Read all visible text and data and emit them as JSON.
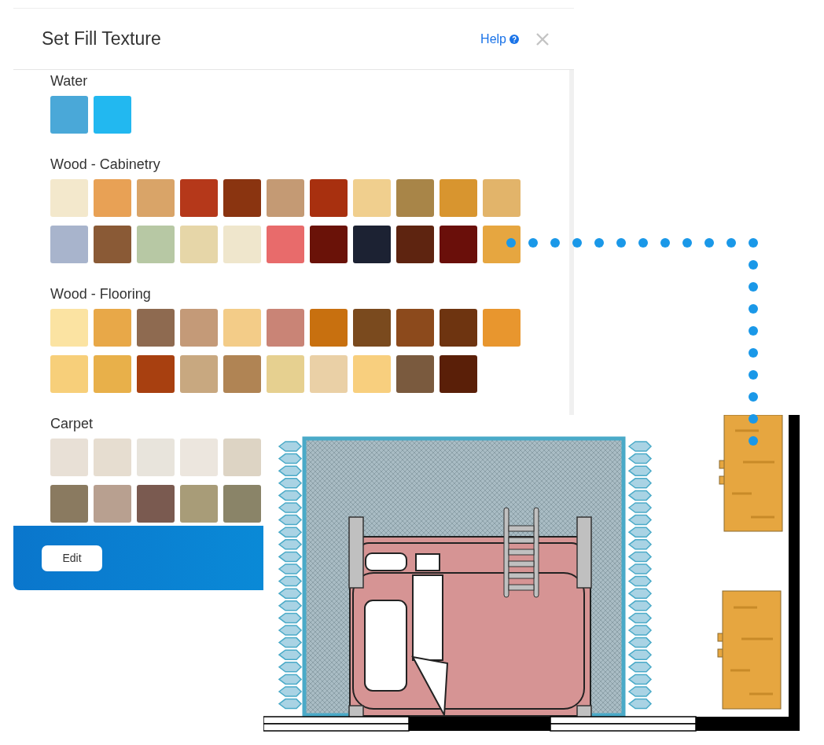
{
  "dialog": {
    "title": "Set Fill Texture",
    "help_link": "Help"
  },
  "sections": [
    {
      "label": "Water",
      "rows": [
        [
          {
            "color": "#4aa8d8"
          },
          {
            "color": "#22b8f0"
          }
        ]
      ]
    },
    {
      "label": "Wood - Cabinetry",
      "rows": [
        [
          {
            "color": "#f3e8cc"
          },
          {
            "color": "#e8a155"
          },
          {
            "color": "#d9a468"
          },
          {
            "color": "#b5381a"
          },
          {
            "color": "#8a3410"
          },
          {
            "color": "#c49a74"
          },
          {
            "color": "#a8300f"
          },
          {
            "color": "#f0cf8e"
          },
          {
            "color": "#a88548"
          },
          {
            "color": "#d8952f"
          },
          {
            "color": "#e2b46a"
          }
        ],
        [
          {
            "color": "#a8b4cc"
          },
          {
            "color": "#8a5a36"
          },
          {
            "color": "#b7c8a4"
          },
          {
            "color": "#e6d6a8"
          },
          {
            "color": "#efe6cc"
          },
          {
            "color": "#e86b6b"
          },
          {
            "color": "#6a1208"
          },
          {
            "color": "#1c2233"
          },
          {
            "color": "#5e2410"
          },
          {
            "color": "#6a0f0a"
          },
          {
            "color": "#e6a640"
          }
        ]
      ]
    },
    {
      "label": "Wood - Flooring",
      "rows": [
        [
          {
            "color": "#fbe3a2"
          },
          {
            "color": "#e8a848"
          },
          {
            "color": "#8e6a50"
          },
          {
            "color": "#c49a78"
          },
          {
            "color": "#f3cc88"
          },
          {
            "color": "#c98476"
          },
          {
            "color": "#c8700f"
          },
          {
            "color": "#7a4a1e"
          },
          {
            "color": "#8c4a1c"
          },
          {
            "color": "#6e3410"
          },
          {
            "color": "#e8962e"
          }
        ],
        [
          {
            "color": "#f7cf7a"
          },
          {
            "color": "#e8b04a"
          },
          {
            "color": "#a84010"
          },
          {
            "color": "#c8a880"
          },
          {
            "color": "#b08454"
          },
          {
            "color": "#e6d090"
          },
          {
            "color": "#ead0a6"
          },
          {
            "color": "#f8cf7e"
          },
          {
            "color": "#7a5a3e"
          },
          {
            "color": "#5a1f08"
          }
        ]
      ]
    },
    {
      "label": "Carpet",
      "rows": [
        [
          {
            "color": "#e8e0d6"
          },
          {
            "color": "#e6ddd0"
          },
          {
            "color": "#e8e4dc"
          },
          {
            "color": "#ece6de"
          },
          {
            "color": "#ddd4c4"
          }
        ],
        [
          {
            "color": "#8a7a60"
          },
          {
            "color": "#b8a090"
          },
          {
            "color": "#7a5a50"
          },
          {
            "color": "#a89c78"
          },
          {
            "color": "#8a8468"
          }
        ]
      ]
    }
  ],
  "footer": {
    "button": "Edit"
  }
}
